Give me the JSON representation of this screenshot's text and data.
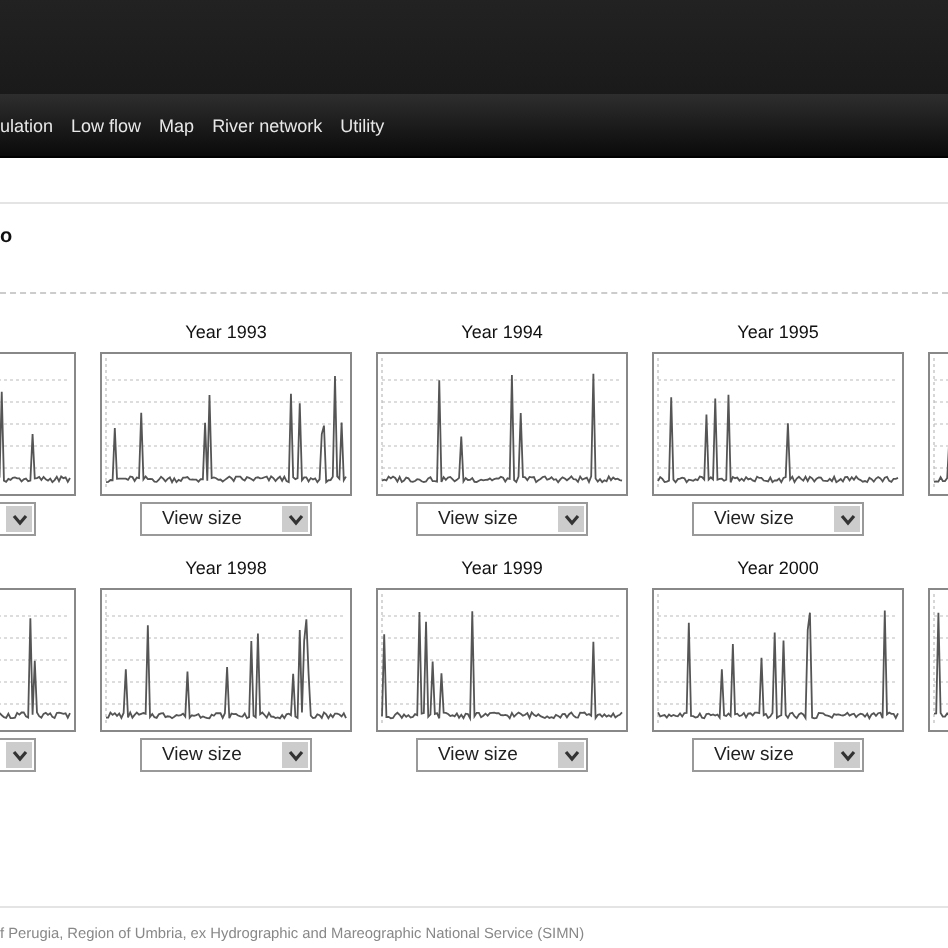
{
  "nav": {
    "items": [
      {
        "label": "ulation"
      },
      {
        "label": "Low flow"
      },
      {
        "label": "Map"
      },
      {
        "label": "River network"
      },
      {
        "label": "Utility"
      }
    ]
  },
  "heading": "o",
  "rows": [
    {
      "cells": [
        {
          "kind": "chart-and-select"
        },
        {
          "kind": "full",
          "title": "Year 1993",
          "select": "View size"
        },
        {
          "kind": "full",
          "title": "Year 1994",
          "select": "View size"
        },
        {
          "kind": "full",
          "title": "Year 1995",
          "select": "View size"
        },
        {
          "kind": "chart"
        }
      ]
    },
    {
      "cells": [
        {
          "kind": "chart-and-select"
        },
        {
          "kind": "full",
          "title": "Year 1998",
          "select": "View size"
        },
        {
          "kind": "full",
          "title": "Year 1999",
          "select": "View size"
        },
        {
          "kind": "full",
          "title": "Year 2000",
          "select": "View size"
        },
        {
          "kind": "chart"
        }
      ]
    }
  ],
  "footer": "f Perugia, Region of Umbria, ex Hydrographic and Mareographic National Service (SIMN)"
}
